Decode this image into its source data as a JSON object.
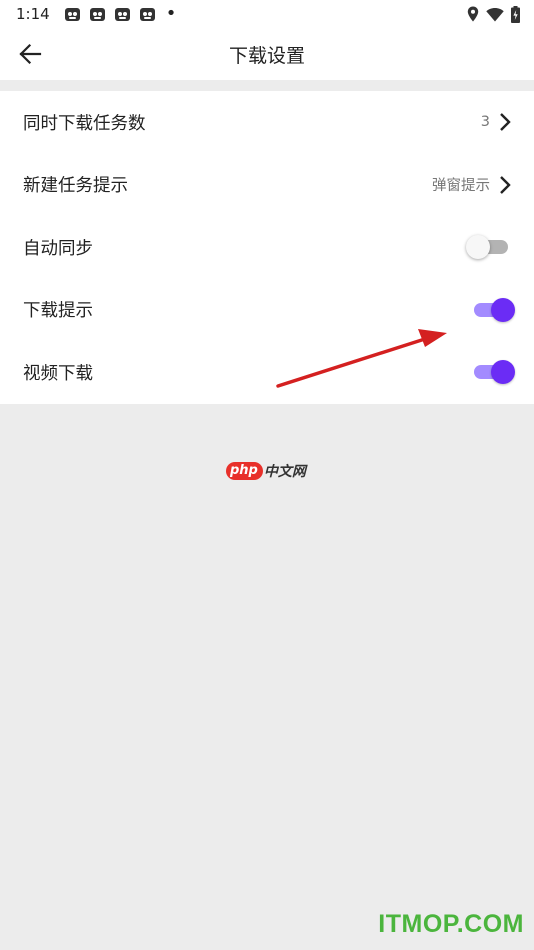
{
  "status_bar": {
    "time": "1:14",
    "app_icons": [
      "notification-app-icon",
      "notification-app-icon",
      "notification-app-icon",
      "notification-app-icon"
    ],
    "dot": "•",
    "right_icons": [
      "location-icon",
      "wifi-icon",
      "battery-icon"
    ]
  },
  "header": {
    "title": "下载设置",
    "back_icon": "back-arrow-icon"
  },
  "settings": {
    "concurrent": {
      "label": "同时下载任务数",
      "value": "3"
    },
    "new_task": {
      "label": "新建任务提示",
      "value": "弹窗提示"
    },
    "auto_sync": {
      "label": "自动同步",
      "enabled": false
    },
    "download_tip": {
      "label": "下载提示",
      "enabled": true
    },
    "video_download": {
      "label": "视频下载",
      "enabled": true
    }
  },
  "colors": {
    "accent": "#6b2cf5",
    "accent_track": "#a38bff",
    "annotation_arrow": "#d42020"
  },
  "watermarks": {
    "php_badge": "php",
    "php_cn": "中文网",
    "itmop": "ITMOP.COM"
  }
}
